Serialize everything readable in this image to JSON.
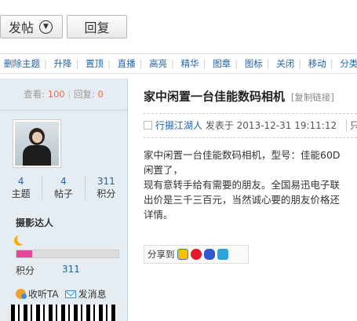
{
  "toolbar": {
    "post_label": "发帖",
    "reply_label": "回复"
  },
  "mod_actions": [
    "删除主题",
    "升降",
    "置顶",
    "直播",
    "高亮",
    "精华",
    "图章",
    "图标",
    "关闭",
    "移动",
    "分类"
  ],
  "thread_stats": {
    "views_label": "查看:",
    "views": "100",
    "replies_label": "回复:",
    "replies": "0"
  },
  "author": {
    "stats": [
      {
        "value": "4",
        "label": "主题"
      },
      {
        "value": "4",
        "label": "帖子"
      },
      {
        "value": "311",
        "label": "积分"
      }
    ],
    "rank": "摄影达人",
    "credits_label": "积分",
    "credits_value": "311",
    "follow_label": "收听TA",
    "message_label": "发消息",
    "level_fill_percent": 15
  },
  "post": {
    "title": "家中闲置一台佳能数码相机",
    "copy_link": "[复制链接]",
    "author": "行摄江湖人",
    "posted_on": "发表于 2013-12-31 19:11:12",
    "more": "只",
    "body": [
      "家中闲置一台佳能数码相机，型号：佳能60D",
      "闲置了，",
      "现有意转手给有需要的朋友。全国易迅电子联",
      "出价是三千三百元，当然诚心要的朋友价格还",
      "详情。"
    ],
    "share_label": "分享到"
  },
  "colors": {
    "link": "#2264a8",
    "sidebar_bg": "#e5edf2",
    "accent_num": "#f26c4f",
    "level_bar": "#e5489b"
  }
}
